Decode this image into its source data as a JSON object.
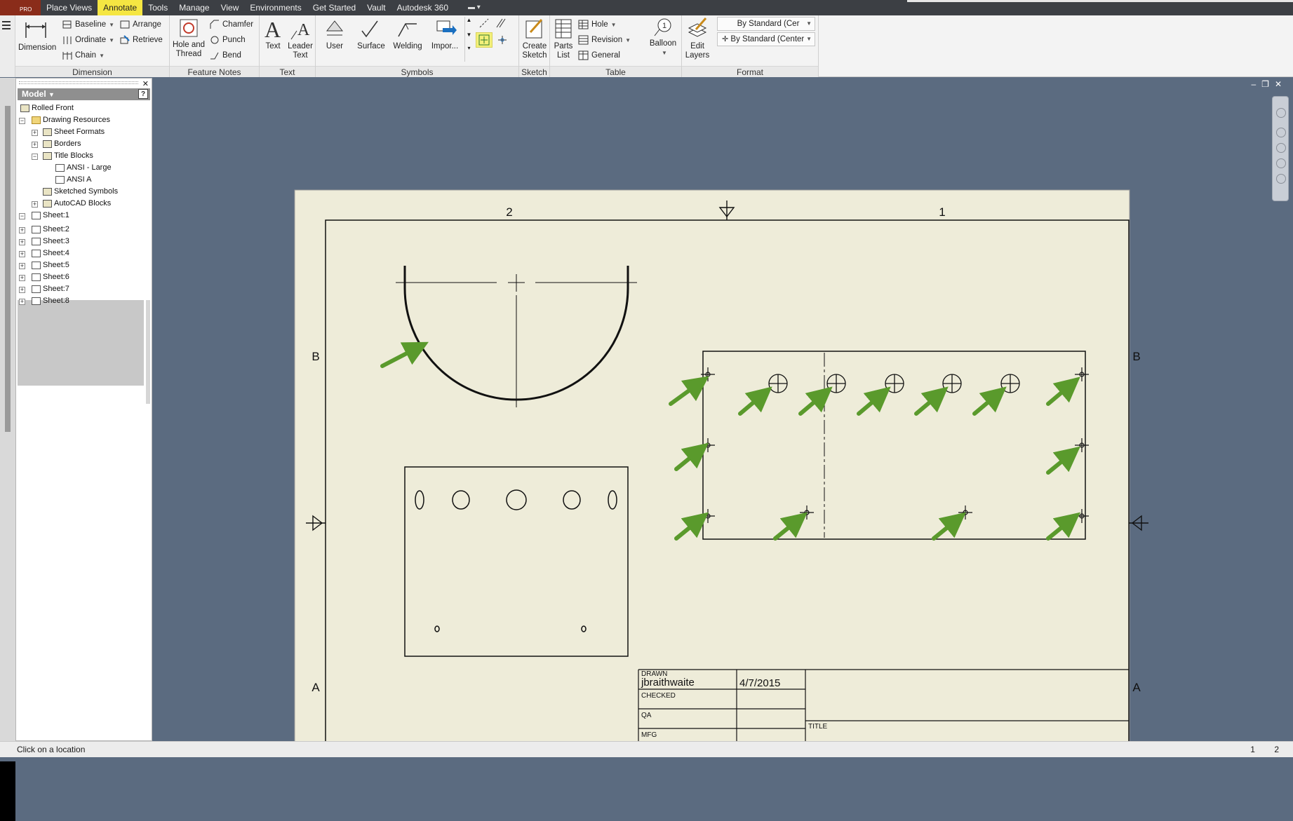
{
  "menu": {
    "app_badge": "PRO",
    "tabs": [
      "Place Views",
      "Annotate",
      "Tools",
      "Manage",
      "View",
      "Environments",
      "Get Started",
      "Vault",
      "Autodesk 360"
    ],
    "active_tab": "Annotate"
  },
  "ribbon": {
    "dimension": {
      "title": "Dimension",
      "big_label": "Dimension",
      "baseline": "Baseline",
      "ordinate": "Ordinate",
      "chain": "Chain",
      "arrange": "Arrange",
      "retrieve": "Retrieve"
    },
    "feature_notes": {
      "title": "Feature Notes",
      "hole_thread_1": "Hole and",
      "hole_thread_2": "Thread",
      "chamfer": "Chamfer",
      "punch": "Punch",
      "bend": "Bend"
    },
    "text": {
      "title": "Text",
      "text_label": "Text",
      "leader_1": "Leader",
      "leader_2": "Text"
    },
    "symbols": {
      "title": "Symbols",
      "user": "User",
      "surface": "Surface",
      "welding": "Welding",
      "import": "Impor..."
    },
    "sketch": {
      "title": "Sketch",
      "create_1": "Create",
      "create_2": "Sketch"
    },
    "table": {
      "title": "Table",
      "parts_1": "Parts",
      "parts_2": "List",
      "hole": "Hole",
      "revision": "Revision",
      "general": "General",
      "balloon": "Balloon"
    },
    "format": {
      "title": "Format",
      "edit_1": "Edit",
      "edit_2": "Layers",
      "style_1": "By Standard (Cer",
      "style_2": "By Standard (Center"
    }
  },
  "browser": {
    "header": "Model",
    "help": "?",
    "items": [
      "Rolled Front",
      "Drawing Resources",
      "Sheet Formats",
      "Borders",
      "Title Blocks",
      "ANSI - Large",
      "ANSI A",
      "Sketched Symbols",
      "AutoCAD Blocks",
      "Sheet:1",
      "Sheet:2",
      "Sheet:3",
      "Sheet:4",
      "Sheet:5",
      "Sheet:6",
      "Sheet:7",
      "Sheet:8"
    ]
  },
  "drawing": {
    "zone_top_left": "2",
    "zone_top_right": "1",
    "zone_b_left": "B",
    "zone_b_right": "B",
    "zone_a_left": "A",
    "zone_a_right": "A",
    "title_block": {
      "drawn_label": "DRAWN",
      "drawn_by": "jbraithwaite",
      "drawn_date": "4/7/2015",
      "checked_label": "CHECKED",
      "qa_label": "QA",
      "mfg_label": "MFG",
      "title_label": "TITLE"
    }
  },
  "status": {
    "prompt": "Click on a location",
    "num1": "1",
    "num2": "2"
  },
  "colors": {
    "canvas_bg": "#5b6b80",
    "sheet_bg": "#eeecd9",
    "arrow_green": "#5a9a2c",
    "active_tab_yellow": "#f5e642"
  }
}
